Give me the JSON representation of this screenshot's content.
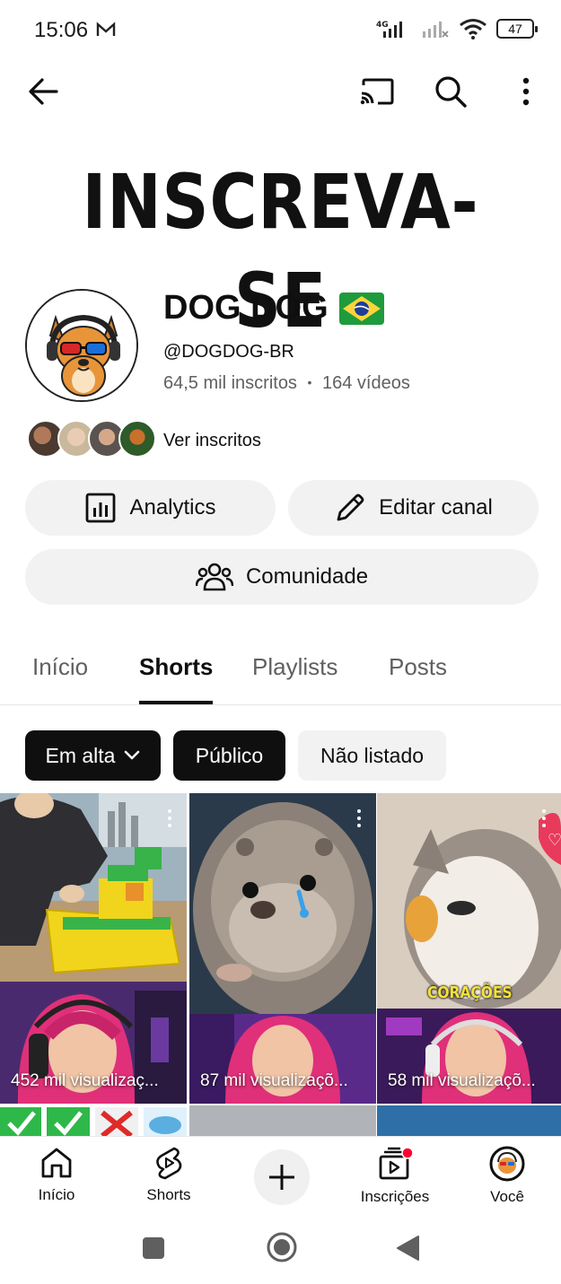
{
  "status_bar": {
    "time": "15:06",
    "network": "4G",
    "battery": "47"
  },
  "app_bar": {
    "back_icon": "arrow-left-icon",
    "cast_icon": "cast-icon",
    "search_icon": "search-icon",
    "more_icon": "more-vert-icon"
  },
  "banner": {
    "text": "INSCREVA-SE"
  },
  "channel": {
    "name": "DOG DOG",
    "flag": "🇧🇷",
    "handle": "@DOGDOG-BR",
    "subscribers": "64,5 mil inscritos",
    "separator": "•",
    "videos": "164 vídeos",
    "see_subscribers": "Ver inscritos"
  },
  "actions": {
    "analytics": "Analytics",
    "edit": "Editar canal",
    "community": "Comunidade"
  },
  "tabs": [
    {
      "label": "Início",
      "active": false
    },
    {
      "label": "Shorts",
      "active": true
    },
    {
      "label": "Playlists",
      "active": false
    },
    {
      "label": "Posts",
      "active": false
    }
  ],
  "filters": {
    "sort": "Em alta",
    "public": "Público",
    "unlisted": "Não listado"
  },
  "shorts": [
    {
      "views": "452 mil visualizaç..."
    },
    {
      "views": "87 mil visualizaçõ..."
    },
    {
      "views": "58 mil visualizaçõ...",
      "overlay": "CORAÇÕES"
    }
  ],
  "bottom_nav": [
    {
      "label": "Início",
      "icon": "home-icon"
    },
    {
      "label": "Shorts",
      "icon": "shorts-icon"
    },
    {
      "label": "",
      "icon": "plus-icon"
    },
    {
      "label": "Inscrições",
      "icon": "subscriptions-icon"
    },
    {
      "label": "Você",
      "icon": "profile-avatar"
    }
  ],
  "colors": {
    "chip_dark": "#0f0f0f",
    "chip_light": "#f2f2f2",
    "secondary_text": "#606060",
    "notification_dot": "#ff0033"
  }
}
